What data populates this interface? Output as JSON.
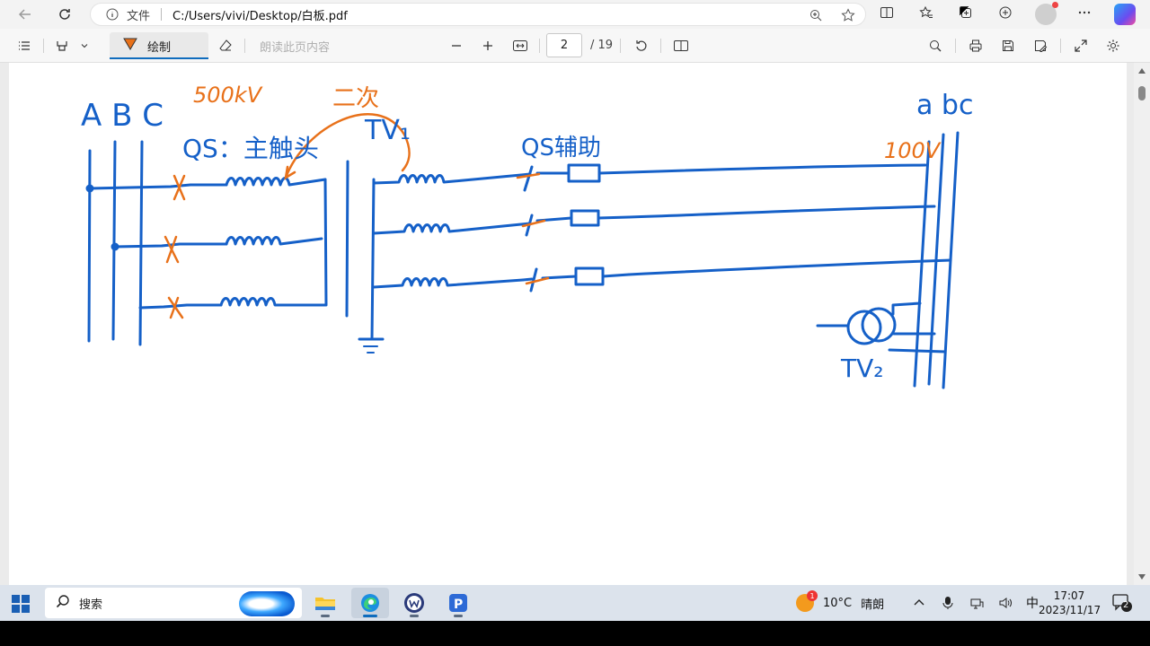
{
  "browser": {
    "address_prefix": "文件",
    "url": "C:/Users/vivi/Desktop/白板.pdf"
  },
  "pdf_toolbar": {
    "draw_label": "绘制",
    "read_aloud_label": "朗读此页内容",
    "current_page": "2",
    "page_total": "/ 19"
  },
  "drawing": {
    "labels": {
      "phases_left": "A B C",
      "voltage_high": "500kV",
      "qs_main": "QS：主触头",
      "tv1": "TV₁",
      "secondary_orange": "二次",
      "qs_aux": "QS辅助",
      "phases_right": "a bc",
      "voltage_low": "100V",
      "tv2": "TV₂"
    },
    "colors": {
      "ink_blue": "#1560c8",
      "ink_orange": "#e8711a"
    }
  },
  "taskbar": {
    "search_label": "搜索",
    "weather_temp": "10°C",
    "weather_text": "晴朗",
    "weather_badge": "1",
    "ime": "中",
    "time": "17:07",
    "date": "2023/11/17",
    "notification_count": "2",
    "apps": [
      "file-explorer",
      "edge",
      "wps-writer",
      "papago"
    ]
  }
}
